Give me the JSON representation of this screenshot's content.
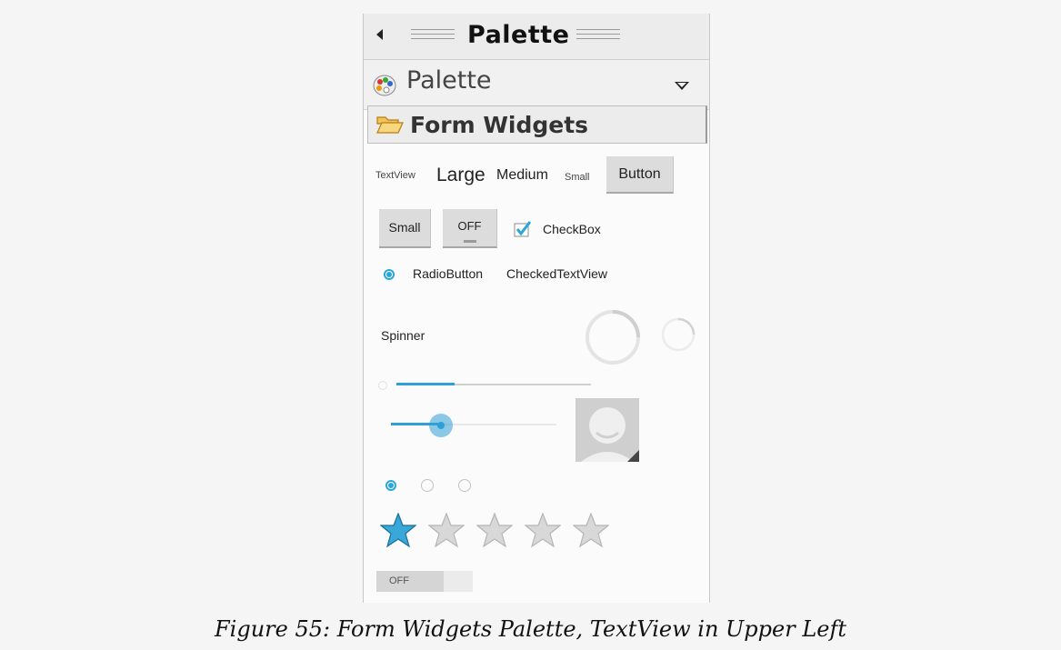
{
  "window": {
    "title": "Palette"
  },
  "dropdown": {
    "selected": "Palette",
    "icon": "palette-icon"
  },
  "drawer": {
    "label": "Form Widgets",
    "icon": "folder-open-icon"
  },
  "widgets": {
    "textviews": {
      "small_textview": "TextView",
      "large": "Large",
      "medium": "Medium",
      "small": "Small"
    },
    "button": "Button",
    "small_button": "Small",
    "toggle": "OFF",
    "checkbox": {
      "label": "CheckBox",
      "checked": true
    },
    "radio_button": "RadioButton",
    "checked_text_view": "CheckedTextView",
    "spinner": "Spinner",
    "progress_horizontal": {
      "value": 0.3
    },
    "seekbar": {
      "value": 0.3
    },
    "radio_group": {
      "selected_index": 0,
      "count": 3
    },
    "rating_bar": {
      "rating": 1,
      "max": 5
    },
    "switch": "OFF"
  },
  "colors": {
    "accent": "#2aa6d8",
    "star_filled": "#3aa7d9",
    "star_empty": "#d8d8d8"
  },
  "caption": "Figure 55: Form Widgets Palette, TextView in Upper Left"
}
